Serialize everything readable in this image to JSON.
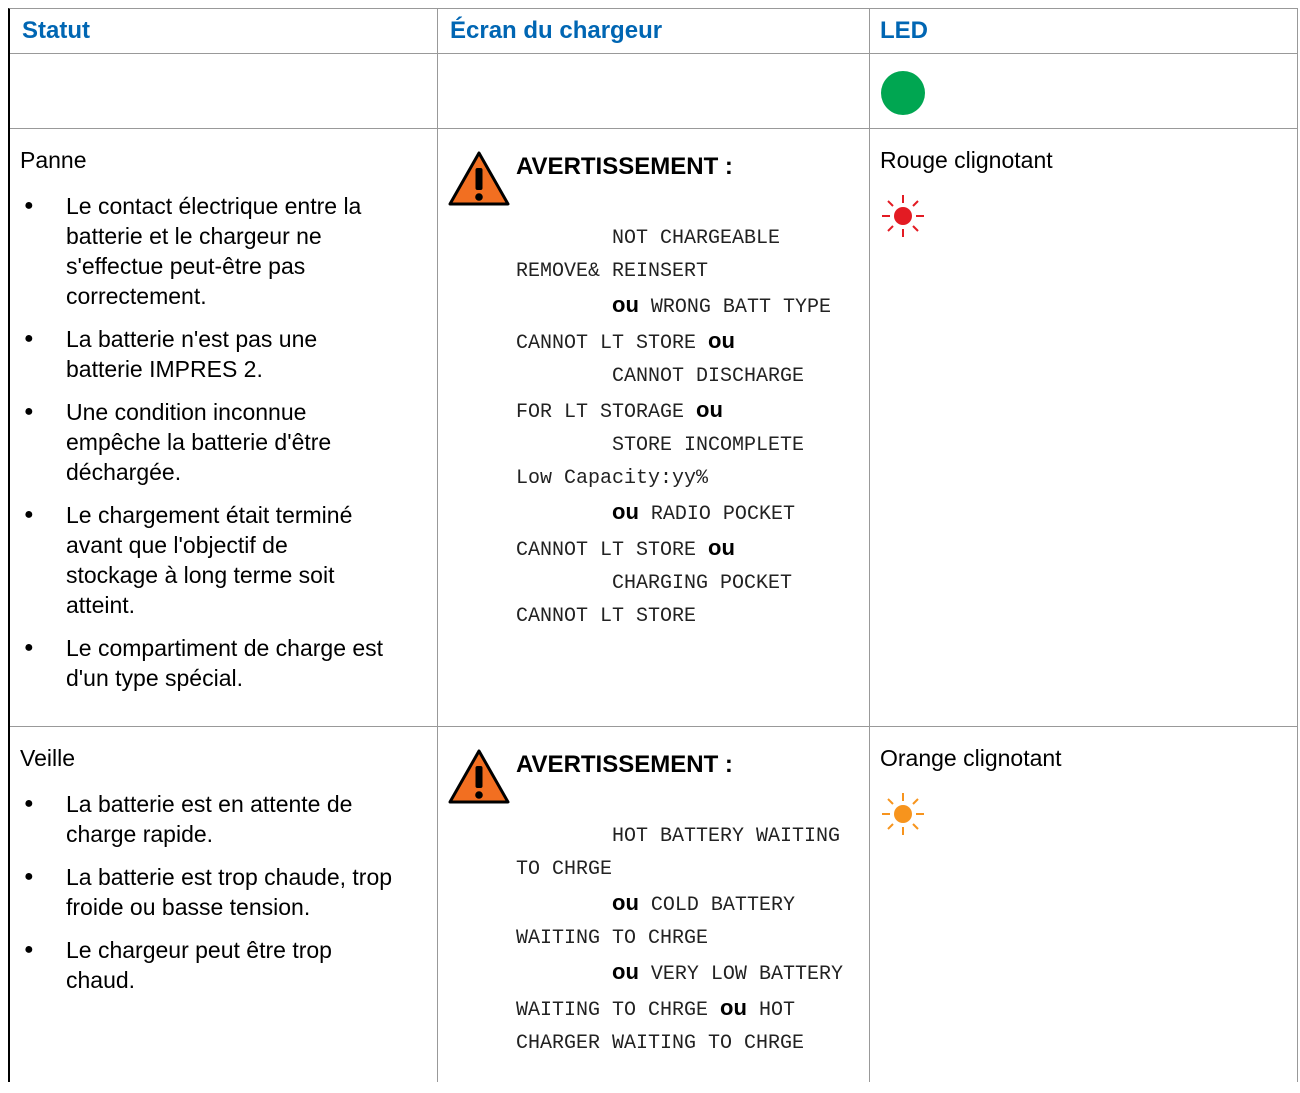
{
  "header": {
    "col_status": "Statut",
    "col_screen": "Écran du chargeur",
    "col_led": "LED"
  },
  "colors": {
    "header_text": "#0066b3",
    "led_green": "#00a651",
    "led_red": "#e31b23",
    "led_orange": "#f7941d",
    "warning_triangle": "#f26f21"
  },
  "rows": [
    {
      "status": "Panne",
      "bullets": [
        "Le contact électrique entre la batterie et le chargeur ne s'effectue peut-être pas correctement.",
        "La batterie n'est pas une batterie IMPRES 2.",
        "Une condition inconnue empêche la batterie d'être déchargée.",
        "Le chargement était terminé avant que l'objectif de stockage à long terme soit atteint.",
        "Le compartiment de charge est d'un type spécial."
      ],
      "warning_title": "AVERTISSEMENT :",
      "screen_messages": [
        "NOT CHARGEABLE REMOVE& REINSERT",
        "WRONG BATT TYPE CANNOT LT STORE",
        "CANNOT DISCHARGE FOR LT STORAGE",
        "STORE INCOMPLETE Low Capacity:yy%",
        "RADIO POCKET CANNOT LT STORE",
        "CHARGING POCKET CANNOT LT STORE"
      ],
      "separator": "ou",
      "led_label": "Rouge clignotant",
      "led_icon": "blinking-red-led-icon"
    },
    {
      "status": "Veille",
      "bullets": [
        "La batterie est en attente de charge rapide.",
        "La batterie est trop chaude, trop froide ou basse tension.",
        "Le chargeur peut être trop chaud."
      ],
      "warning_title": "AVERTISSEMENT :",
      "screen_messages": [
        "HOT BATTERY WAITING TO CHRGE",
        "COLD BATTERY WAITING TO CHRGE",
        "VERY LOW BATTERY WAITING TO CHRGE",
        "HOT CHARGER WAITING TO CHRGE"
      ],
      "separator": "ou",
      "led_label": "Orange clignotant",
      "led_icon": "blinking-orange-led-icon"
    }
  ],
  "row_empty": {
    "led_icon": "solid-green-led-icon"
  }
}
